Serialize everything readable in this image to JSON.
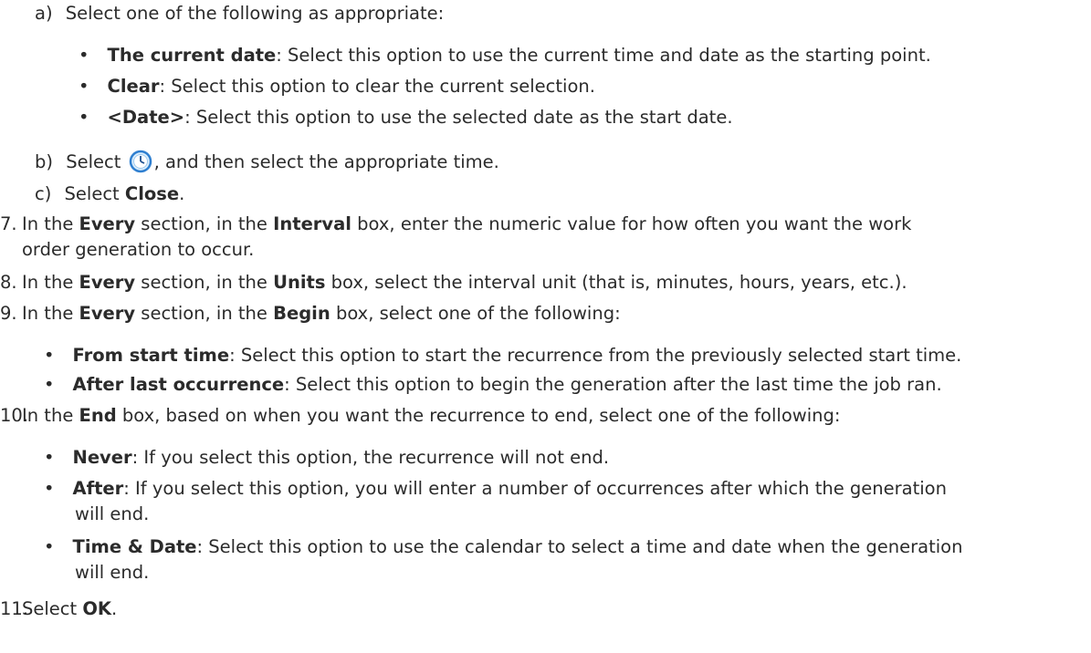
{
  "sub_a": {
    "label": "a)",
    "text": "Select one of the following as appropriate:"
  },
  "date_options": [
    {
      "bold": "The current date",
      "rest": ": Select this option to use the current time and date as the starting point."
    },
    {
      "bold": "Clear",
      "rest": ": Select this option to clear the current selection."
    },
    {
      "bold": "<Date>",
      "rest": ": Select this option to use the selected date as the start date."
    }
  ],
  "sub_b": {
    "label": "b)",
    "pre": "Select ",
    "icon": "clock-icon",
    "post": ", and then select the appropriate time."
  },
  "sub_c": {
    "label": "c)",
    "pre": "Select ",
    "bold": "Close",
    "post": "."
  },
  "step7": {
    "num": "7.",
    "p1": "In the ",
    "b1": "Every",
    "p2": " section, in the ",
    "b2": "Interval",
    "p3": " box, enter the numeric value for how often you want the work",
    "line2": "order generation to occur."
  },
  "step8": {
    "num": "8.",
    "p1": "In the ",
    "b1": "Every",
    "p2": " section, in the ",
    "b2": "Units",
    "p3": " box, select the interval unit (that is, minutes, hours, years, etc.)."
  },
  "step9": {
    "num": "9.",
    "p1": "In the ",
    "b1": "Every",
    "p2": " section, in the ",
    "b2": "Begin",
    "p3": " box, select one of the following:"
  },
  "begin_options": [
    {
      "bold": "From start time",
      "rest": ": Select this option to start the recurrence from the previously selected start time."
    },
    {
      "bold": "After last occurrence",
      "rest": ": Select this option to begin the generation after the last time the job ran."
    }
  ],
  "step10": {
    "num": "10.",
    "p1": "In the ",
    "b1": "End",
    "p2": " box, based on when you want the recurrence to end, select one of the following:"
  },
  "end_options": [
    {
      "bold": "Never",
      "rest": ": If you select this option, the recurrence will not end.",
      "line2": ""
    },
    {
      "bold": "After",
      "rest": ": If you select this option, you will enter a number of occurrences after which the generation",
      "line2": "will end."
    },
    {
      "bold": "Time & Date",
      "rest": ": Select this option to use the calendar to select a time and date when the generation",
      "line2": "will end."
    }
  ],
  "step11": {
    "num": "11.",
    "p1": "Select ",
    "b1": "OK",
    "p2": "."
  },
  "bullet_char": "•"
}
